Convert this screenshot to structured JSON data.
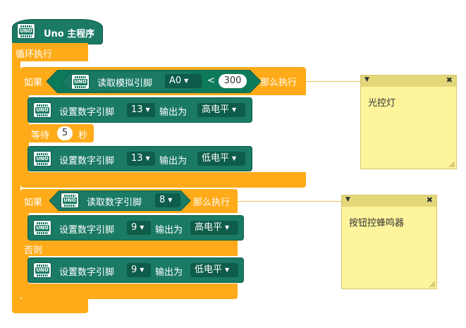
{
  "hat": {
    "label": "Uno 主程序"
  },
  "loop": {
    "label": "循环执行"
  },
  "if1": {
    "if_label": "如果",
    "then_label": "那么执行",
    "condition": {
      "label": "读取模拟引脚",
      "pin": "A0",
      "operator": "<",
      "value": "300"
    },
    "body": [
      {
        "label": "设置数字引脚",
        "pin": "13",
        "out_label": "输出为",
        "level": "高电平"
      },
      {
        "wait_label": "等待",
        "wait_value": "5",
        "unit": "秒"
      },
      {
        "label": "设置数字引脚",
        "pin": "13",
        "out_label": "输出为",
        "level": "低电平"
      }
    ]
  },
  "if2": {
    "if_label": "如果",
    "then_label": "那么执行",
    "else_label": "否则",
    "condition": {
      "label": "读取数字引脚",
      "pin": "8"
    },
    "then_body": {
      "label": "设置数字引脚",
      "pin": "9",
      "out_label": "输出为",
      "level": "高电平"
    },
    "else_body": {
      "label": "设置数字引脚",
      "pin": "9",
      "out_label": "输出为",
      "level": "低电平"
    }
  },
  "notes": [
    {
      "text": "光控灯"
    },
    {
      "text": "按钮控蜂鸣器"
    }
  ],
  "icon_text": "UNO",
  "dropdown_arrow": "▼",
  "note_collapse_icon": "▼",
  "note_close_icon": "✖",
  "colors": {
    "control": "#FFAB19",
    "arduino": "#1A7A64",
    "note": "#FEF49C"
  }
}
